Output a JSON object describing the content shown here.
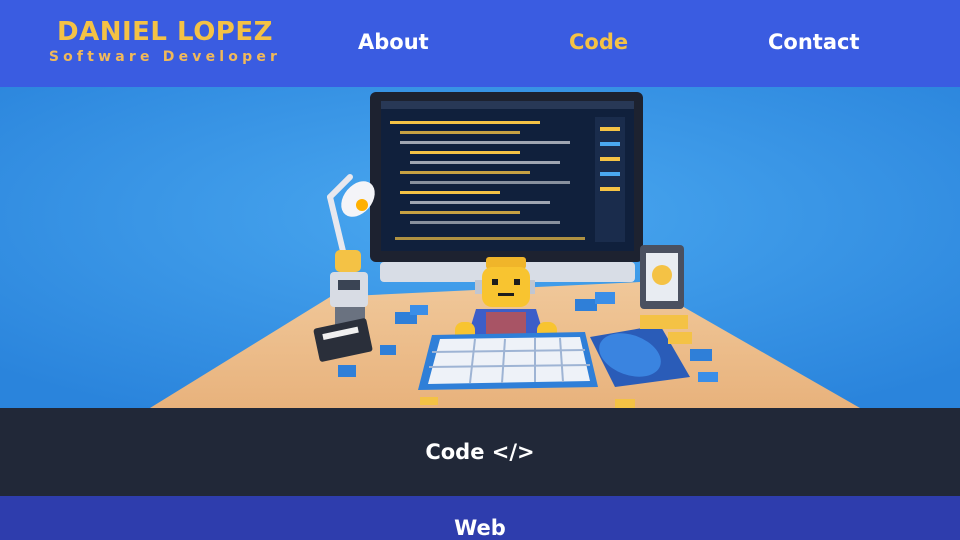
{
  "brand": {
    "name": "DANIEL LOPEZ",
    "tagline": "Software Developer"
  },
  "nav": {
    "items": [
      {
        "label": "About",
        "active": false
      },
      {
        "label": "Code",
        "active": true
      },
      {
        "label": "Contact",
        "active": false
      }
    ]
  },
  "hero": {
    "image": "lego-developer-at-computer-illustration"
  },
  "sections": [
    {
      "title": "Code </>"
    },
    {
      "title": "Web"
    }
  ],
  "colors": {
    "header_bg": "#3a5ce1",
    "accent": "#f4c245",
    "dark_band": "#212838",
    "blue_band": "#2e3dad"
  }
}
